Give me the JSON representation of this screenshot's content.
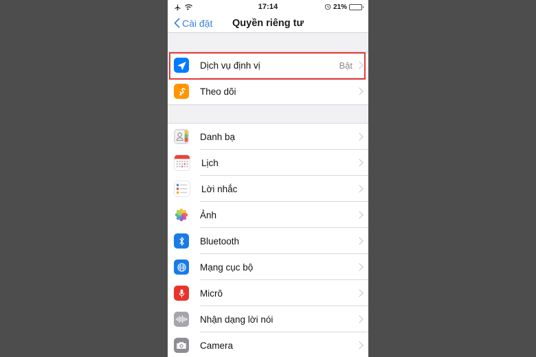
{
  "statusbar": {
    "airplane_icon": "airplane-mode-icon",
    "wifi_icon": "wifi-icon",
    "time": "17:14",
    "alarm_icon": "alarm-icon",
    "battery_percent": "21%",
    "battery_icon": "battery-icon"
  },
  "navbar": {
    "back_label": "Cài đặt",
    "back_chevron": "chevron-left-icon",
    "title": "Quyền riêng tư"
  },
  "colors": {
    "accent": "#3b82d6",
    "highlight": "#e33a3a",
    "location_blue": "#007aff",
    "tracking_orange": "#ff9500",
    "mic_red": "#ff3b30",
    "gray_icon": "#8e8e93"
  },
  "sections": [
    {
      "name": "privacy-primary",
      "rows": [
        {
          "icon": "location-arrow-icon",
          "label": "Dịch vụ định vị",
          "value": "Bật",
          "highlighted": true
        },
        {
          "icon": "tracking-icon",
          "label": "Theo dõi",
          "value": ""
        }
      ]
    },
    {
      "name": "privacy-apps",
      "rows": [
        {
          "icon": "contacts-icon",
          "label": "Danh bạ",
          "value": ""
        },
        {
          "icon": "calendar-icon",
          "label": "Lịch",
          "value": ""
        },
        {
          "icon": "reminders-icon",
          "label": "Lời nhắc",
          "value": ""
        },
        {
          "icon": "photos-icon",
          "label": "Ảnh",
          "value": ""
        },
        {
          "icon": "bluetooth-icon",
          "label": "Bluetooth",
          "value": ""
        },
        {
          "icon": "local-network-icon",
          "label": "Mạng cục bộ",
          "value": ""
        },
        {
          "icon": "microphone-icon",
          "label": "Micrô",
          "value": ""
        },
        {
          "icon": "speech-recognition-icon",
          "label": "Nhận dạng lời nói",
          "value": ""
        },
        {
          "icon": "camera-icon",
          "label": "Camera",
          "value": ""
        }
      ]
    }
  ]
}
